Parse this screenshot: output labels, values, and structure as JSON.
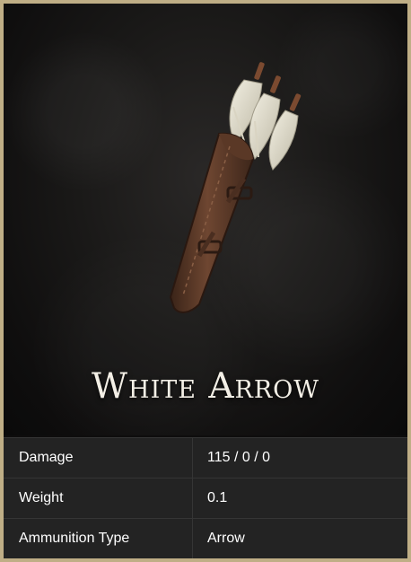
{
  "item": {
    "name": "White Arrow",
    "image_icon": "quiver-with-white-fletched-arrows-icon"
  },
  "stats": [
    {
      "label": "Damage",
      "value": "115 / 0 / 0"
    },
    {
      "label": "Weight",
      "value": "0.1"
    },
    {
      "label": "Ammunition Type",
      "value": "Arrow"
    }
  ],
  "colors": {
    "frame": "#bfae86",
    "background": "#0e0d0d",
    "table": "#232323",
    "text": "#ffffff"
  }
}
